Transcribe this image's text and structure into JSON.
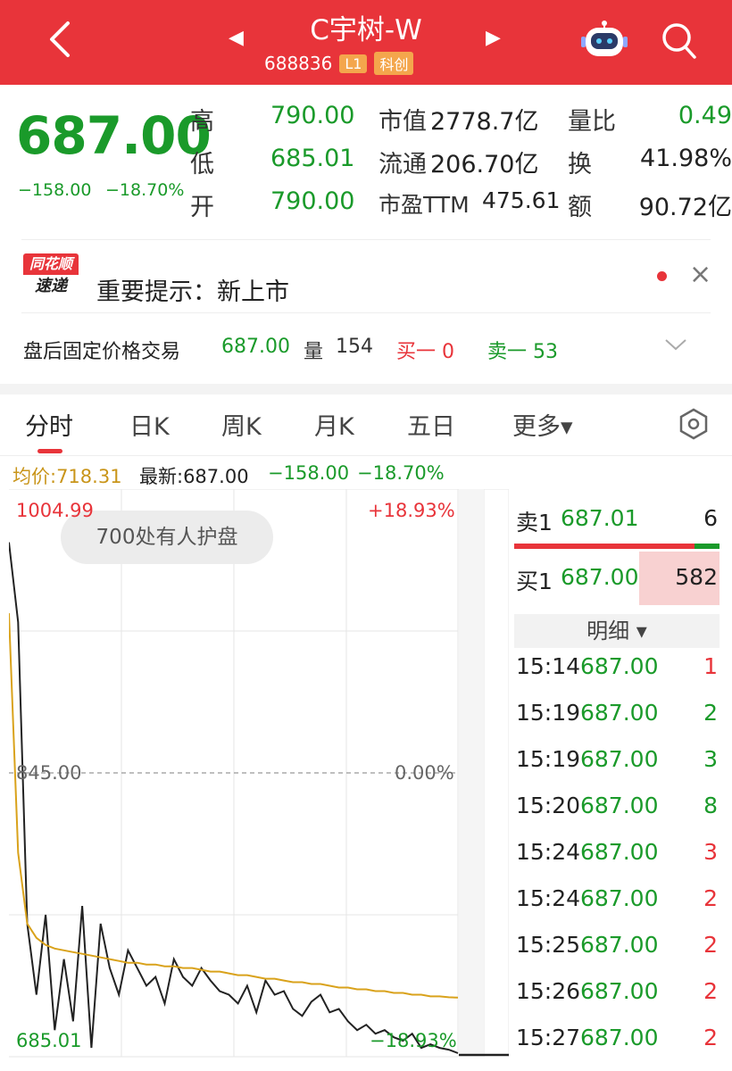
{
  "header": {
    "title": "C宇树-W",
    "code": "688836",
    "badge_l1": "L1",
    "badge_kc": "科创"
  },
  "quote": {
    "price": "687.00",
    "change": "−158.00",
    "change_pct": "−18.70%",
    "high_label": "高",
    "high": "790.00",
    "low_label": "低",
    "low": "685.01",
    "open_label": "开",
    "open": "790.00",
    "mcap_label": "市值",
    "mcap": "2778.7亿",
    "float_label": "流通",
    "float": "206.70亿",
    "pe_label": "市盈TTM",
    "pe": "475.61",
    "vr_label": "量比",
    "vr": "0.49",
    "turn_label": "换",
    "turn": "41.98%",
    "amt_label": "额",
    "amt": "90.72亿"
  },
  "alert": {
    "logo_top": "同花顺",
    "logo_bottom": "速递",
    "text": "重要提示：新上市"
  },
  "after_hours": {
    "label": "盘后固定价格交易",
    "price": "687.00",
    "vol_label": "量",
    "vol": "154",
    "buy1": "买一 0",
    "sell1": "卖一 53"
  },
  "tabs": [
    "分时",
    "日K",
    "周K",
    "月K",
    "五日",
    "更多▾"
  ],
  "subheader": {
    "avg": "均价:718.31",
    "latest": "最新:687.00",
    "chg": "−158.00",
    "chg_pct": "−18.70%"
  },
  "chart_labels": {
    "top_left": "1004.99",
    "top_right": "+18.93%",
    "mid_left": "845.00",
    "mid_right": "0.00%",
    "bottom_left": "685.01",
    "bottom_right": "−18.93%",
    "pill": "700处有人护盘"
  },
  "chart_data": {
    "type": "line",
    "ylim": [
      685.01,
      1004.99
    ],
    "series": [
      {
        "values": [
          975,
          930,
          760,
          720,
          765,
          700,
          740,
          705,
          770,
          690,
          760,
          735,
          720,
          745,
          735,
          725,
          730,
          715,
          740,
          730,
          725,
          735,
          728,
          722,
          720,
          715,
          725,
          710,
          728,
          720,
          722,
          712,
          708,
          716,
          720,
          710,
          712,
          705,
          700,
          703,
          698,
          700,
          696,
          694,
          698,
          690,
          692,
          690,
          689,
          687
        ]
      },
      {
        "values": [
          935,
          800,
          760,
          752,
          748,
          746,
          745,
          744,
          743,
          742,
          741,
          740,
          739,
          738,
          738,
          737,
          737,
          736,
          736,
          735,
          735,
          734,
          733,
          733,
          732,
          731,
          731,
          730,
          729,
          729,
          728,
          727,
          727,
          726,
          726,
          725,
          724,
          724,
          723,
          723,
          722,
          722,
          721,
          721,
          720,
          720,
          719,
          719,
          718.5,
          718.31
        ]
      }
    ]
  },
  "orderbook": {
    "sell1_label": "卖1",
    "sell1_price": "687.01",
    "sell1_vol": "6",
    "buy1_label": "买1",
    "buy1_price": "687.00",
    "buy1_vol": "582",
    "detail_label": "明细 ▾"
  },
  "ticks": [
    {
      "time": "15:14",
      "price": "687.00",
      "vol": "1",
      "color": "red"
    },
    {
      "time": "15:19",
      "price": "687.00",
      "vol": "2",
      "color": "green"
    },
    {
      "time": "15:19",
      "price": "687.00",
      "vol": "3",
      "color": "green"
    },
    {
      "time": "15:20",
      "price": "687.00",
      "vol": "8",
      "color": "green"
    },
    {
      "time": "15:24",
      "price": "687.00",
      "vol": "3",
      "color": "red"
    },
    {
      "time": "15:24",
      "price": "687.00",
      "vol": "2",
      "color": "red"
    },
    {
      "time": "15:25",
      "price": "687.00",
      "vol": "2",
      "color": "red"
    },
    {
      "time": "15:26",
      "price": "687.00",
      "vol": "2",
      "color": "red"
    },
    {
      "time": "15:27",
      "price": "687.00",
      "vol": "2",
      "color": "red"
    }
  ]
}
